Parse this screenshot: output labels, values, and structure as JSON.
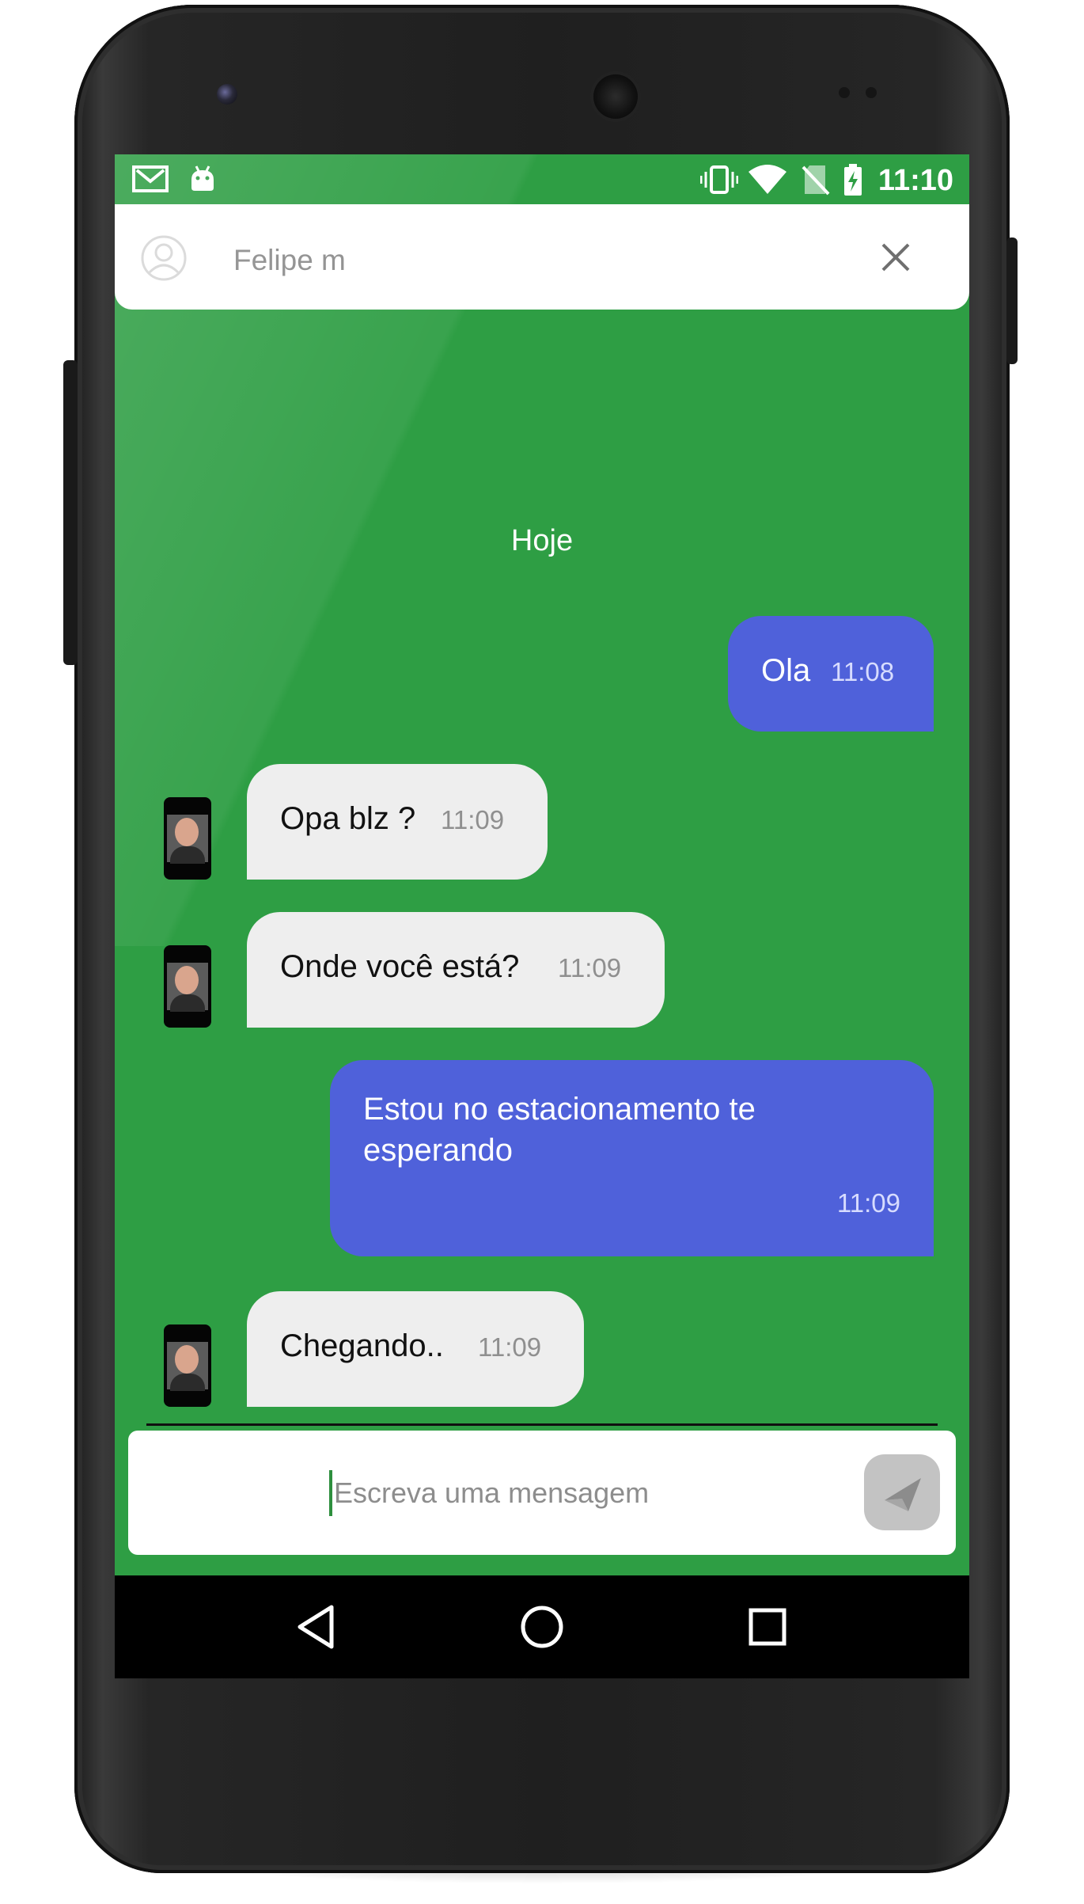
{
  "status_bar": {
    "time": "11:10",
    "left_icons": [
      "gmail-icon",
      "android-icon"
    ],
    "right_icons": [
      "vibrate-icon",
      "wifi-icon",
      "no-sim-icon",
      "battery-charging-icon"
    ]
  },
  "header": {
    "contact_name": "Felipe m",
    "avatar_icon": "person-icon",
    "close_icon": "close-icon"
  },
  "conversation": {
    "day_label": "Hoje",
    "messages": [
      {
        "direction": "outgoing",
        "text": "Ola",
        "time": "11:08"
      },
      {
        "direction": "incoming",
        "text": "Opa blz ?",
        "time": "11:09"
      },
      {
        "direction": "incoming",
        "text": "Onde você está?",
        "time": "11:09"
      },
      {
        "direction": "outgoing",
        "text": "Estou no estacionamento te esperando",
        "time": "11:09"
      },
      {
        "direction": "incoming",
        "text": "Chegando..",
        "time": "11:09"
      }
    ]
  },
  "composer": {
    "placeholder": "Escreva uma mensagem",
    "send_icon": "send-icon"
  },
  "nav_bar": {
    "buttons": [
      "back-icon",
      "home-icon",
      "recents-icon"
    ]
  },
  "colors": {
    "background_green": "#2e9e44",
    "outgoing_bubble": "#4f61da",
    "incoming_bubble": "#eeeeee",
    "header_white": "#ffffff"
  }
}
